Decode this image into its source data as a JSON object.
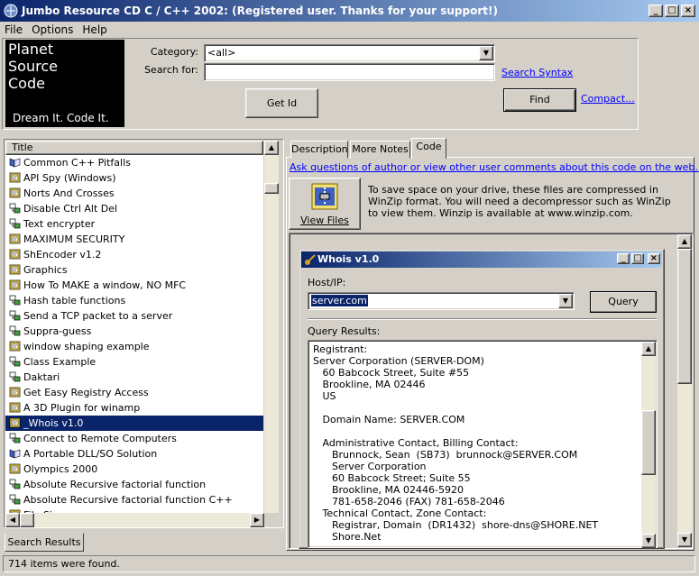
{
  "window": {
    "title": "Jumbo Resource CD C / C++ 2002: (Registered user.  Thanks for your support!)",
    "buttons": [
      "_",
      "□",
      "×"
    ]
  },
  "menu": [
    "File",
    "Options",
    "Help"
  ],
  "logo": {
    "line1": "Planet",
    "line2": "Source",
    "line3": "Code",
    "tagline": "Dream It.  Code It."
  },
  "search": {
    "category_label": "Category:",
    "category_value": "<all>",
    "search_label": "Search for:",
    "search_value": "",
    "search_syntax": "Search Syntax",
    "find": "Find",
    "compact": "Compact...",
    "get_id": "Get Id"
  },
  "list": {
    "header": "Title",
    "items": [
      {
        "label": "Common C++ Pitfalls",
        "icon": "book-icon",
        "selected": false
      },
      {
        "label": "API Spy (Windows)",
        "icon": "code-icon",
        "selected": false
      },
      {
        "label": "Norts And Crosses",
        "icon": "code-icon",
        "selected": false
      },
      {
        "label": "Disable Ctrl Alt Del",
        "icon": "tree-icon",
        "selected": false
      },
      {
        "label": "Text encrypter",
        "icon": "tree-icon",
        "selected": false
      },
      {
        "label": "MAXIMUM SECURITY",
        "icon": "code-icon",
        "selected": false
      },
      {
        "label": "ShEncoder v1.2",
        "icon": "code-icon",
        "selected": false
      },
      {
        "label": "Graphics",
        "icon": "code-icon",
        "selected": false
      },
      {
        "label": "How To MAKE a window, NO MFC",
        "icon": "code-icon",
        "selected": false
      },
      {
        "label": "Hash table functions",
        "icon": "tree-icon",
        "selected": false
      },
      {
        "label": "Send a TCP packet to a server",
        "icon": "tree-icon",
        "selected": false
      },
      {
        "label": "Suppra-guess",
        "icon": "tree-icon",
        "selected": false
      },
      {
        "label": "window shaping example",
        "icon": "code-icon",
        "selected": false
      },
      {
        "label": "Class Example",
        "icon": "tree-icon",
        "selected": false
      },
      {
        "label": "Daktari",
        "icon": "tree-icon",
        "selected": false
      },
      {
        "label": "Get Easy Registry Access",
        "icon": "code-icon",
        "selected": false
      },
      {
        "label": "A 3D Plugin for winamp",
        "icon": "code-icon",
        "selected": false
      },
      {
        "label": "_Whois v1.0",
        "icon": "code-icon",
        "selected": true
      },
      {
        "label": "Connect to Remote Computers",
        "icon": "tree-icon",
        "selected": false
      },
      {
        "label": "A Portable DLL/SO Solution",
        "icon": "book-icon",
        "selected": false
      },
      {
        "label": "Olympics 2000",
        "icon": "code-icon",
        "selected": false
      },
      {
        "label": "Absolute Recursive factorial function",
        "icon": "tree-icon",
        "selected": false
      },
      {
        "label": "Absolute Recursive factorial function C++",
        "icon": "tree-icon",
        "selected": false
      },
      {
        "label": "File Si...",
        "icon": "code-icon",
        "selected": false
      }
    ],
    "bottom_tab": "Search Results"
  },
  "tabs": [
    "Description",
    "More Notes",
    "Code"
  ],
  "active_tab": "Code",
  "ask_link": "Ask questions of author or view other user comments about this code on the web...",
  "view_files": "View Files",
  "compress_note": "To save space on your drive, these files are compressed in WinZip format.  You will need a decompressor such as WinZip to view them.  Winzip is available at www.winzip.com.",
  "whois": {
    "title": "Whois v1.0",
    "host_label": "Host/IP:",
    "host_value": "server.com",
    "query": "Query",
    "results_label": "Query Results:",
    "results": [
      "Registrant:",
      "Server Corporation (SERVER-DOM)",
      "   60 Babcock Street, Suite #55",
      "   Brookline, MA 02446",
      "   US",
      "",
      "   Domain Name: SERVER.COM",
      "",
      "   Administrative Contact, Billing Contact:",
      "      Brunnock, Sean  (SB73)  brunnock@SERVER.COM",
      "      Server Corporation",
      "      60 Babcock Street; Suite 55",
      "      Brookline, MA 02446-5920",
      "      781-658-2046 (FAX) 781-658-2046",
      "   Technical Contact, Zone Contact:",
      "      Registrar, Domain  (DR1432)  shore-dns@SHORE.NET",
      "      Shore.Net"
    ]
  },
  "status": "714 items were found.",
  "colors": {
    "titlebar": "#0a246a",
    "selection": "#0a246a",
    "link": "#0000ff",
    "face": "#d4d0c8"
  }
}
